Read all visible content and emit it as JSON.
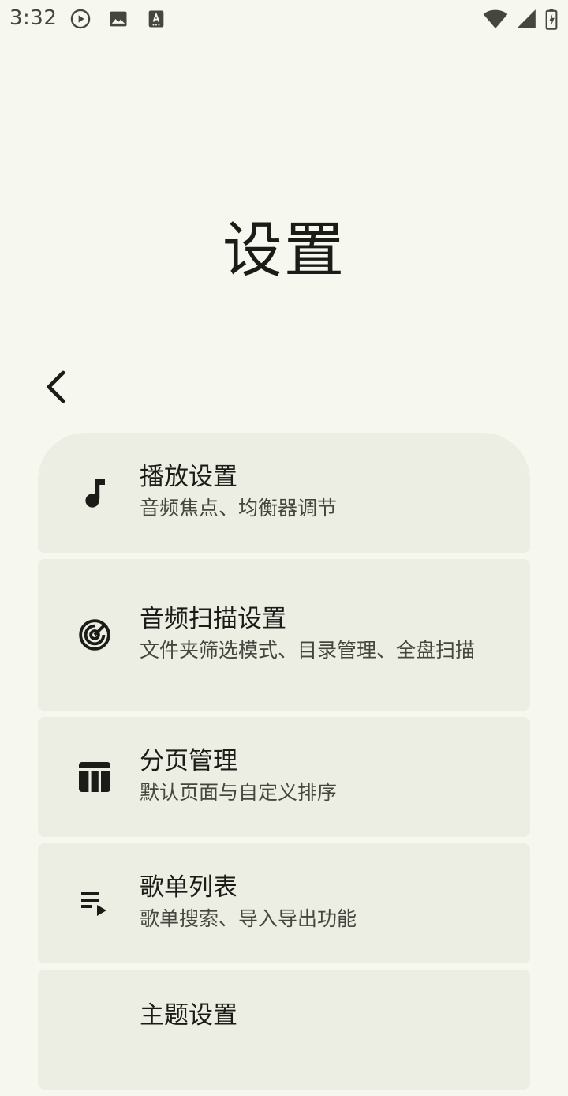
{
  "status_bar": {
    "time": "3:32"
  },
  "page": {
    "title": "设置"
  },
  "settings": [
    {
      "title": "播放设置",
      "subtitle": "音频焦点、均衡器调节",
      "icon": "music-note-icon"
    },
    {
      "title": "音频扫描设置",
      "subtitle": "文件夹筛选模式、目录管理、全盘扫描",
      "icon": "scan-target-icon"
    },
    {
      "title": "分页管理",
      "subtitle": "默认页面与自定义排序",
      "icon": "tab-columns-icon"
    },
    {
      "title": "歌单列表",
      "subtitle": "歌单搜索、导入导出功能",
      "icon": "playlist-icon"
    },
    {
      "title": "主题设置",
      "subtitle": "",
      "icon": "palette-icon"
    }
  ],
  "colors": {
    "background": "#f6f7ef",
    "card": "#edeee3",
    "text_primary": "#1b1c18",
    "text_secondary": "#45473f"
  }
}
